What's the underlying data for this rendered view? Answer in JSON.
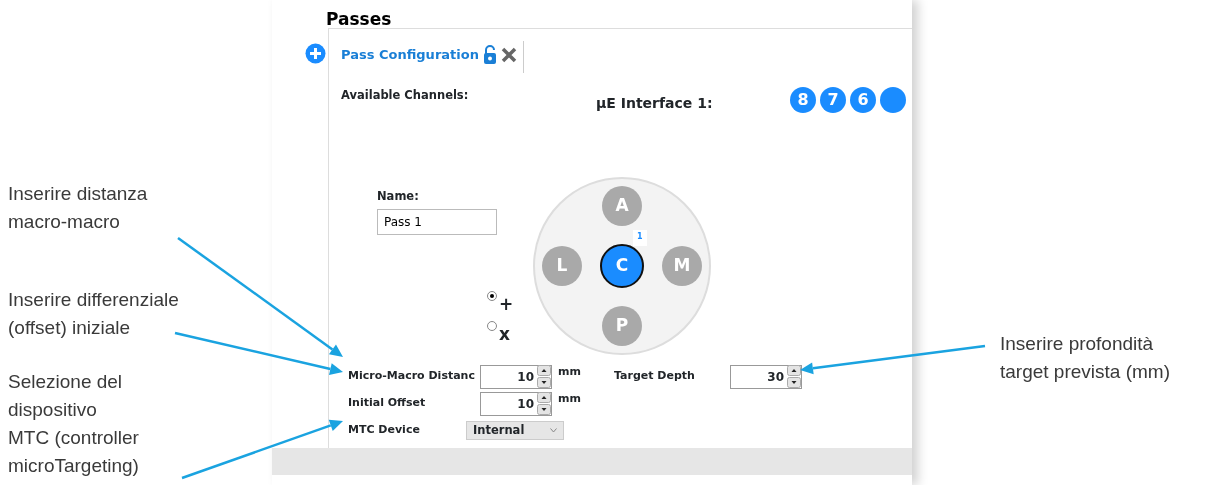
{
  "panel": {
    "title": "Passes",
    "tab_label": "Pass Configuration"
  },
  "channels": {
    "label": "Available Channels:",
    "interface_label": "µE Interface 1:",
    "numbers": [
      "8",
      "7",
      "6"
    ]
  },
  "name": {
    "label": "Name:",
    "value": "Pass 1"
  },
  "electrode_pad": {
    "positions": [
      {
        "label": "A",
        "selected": false
      },
      {
        "label": "L",
        "selected": false
      },
      {
        "label": "C",
        "selected": true,
        "badge": "1"
      },
      {
        "label": "M",
        "selected": false
      },
      {
        "label": "P",
        "selected": false
      }
    ]
  },
  "pattern": [
    {
      "label": "+",
      "selected": true
    },
    {
      "label": "x",
      "selected": false
    }
  ],
  "fields": [
    {
      "label": "Micro-Macro Distanc",
      "value": "10",
      "unit": "mm"
    },
    {
      "label": "Initial Offset",
      "value": "10",
      "unit": "mm"
    }
  ],
  "target_depth": {
    "label": "Target Depth",
    "value": "30"
  },
  "mtc_device": {
    "label": "MTC Device",
    "value": "Internal"
  },
  "left_annotations": [
    {
      "lines": [
        "Inserire distanza",
        "macro-macro"
      ]
    },
    {
      "lines": [
        "Inserire differenziale",
        "(offset) iniziale"
      ]
    },
    {
      "lines": [
        "Selezione del",
        "dispositivo",
        "MTC (controller",
        "microTargeting)"
      ]
    }
  ],
  "right_annotations": [
    {
      "lines": [
        "Inserire profondità",
        "target prevista (mm)"
      ]
    }
  ]
}
